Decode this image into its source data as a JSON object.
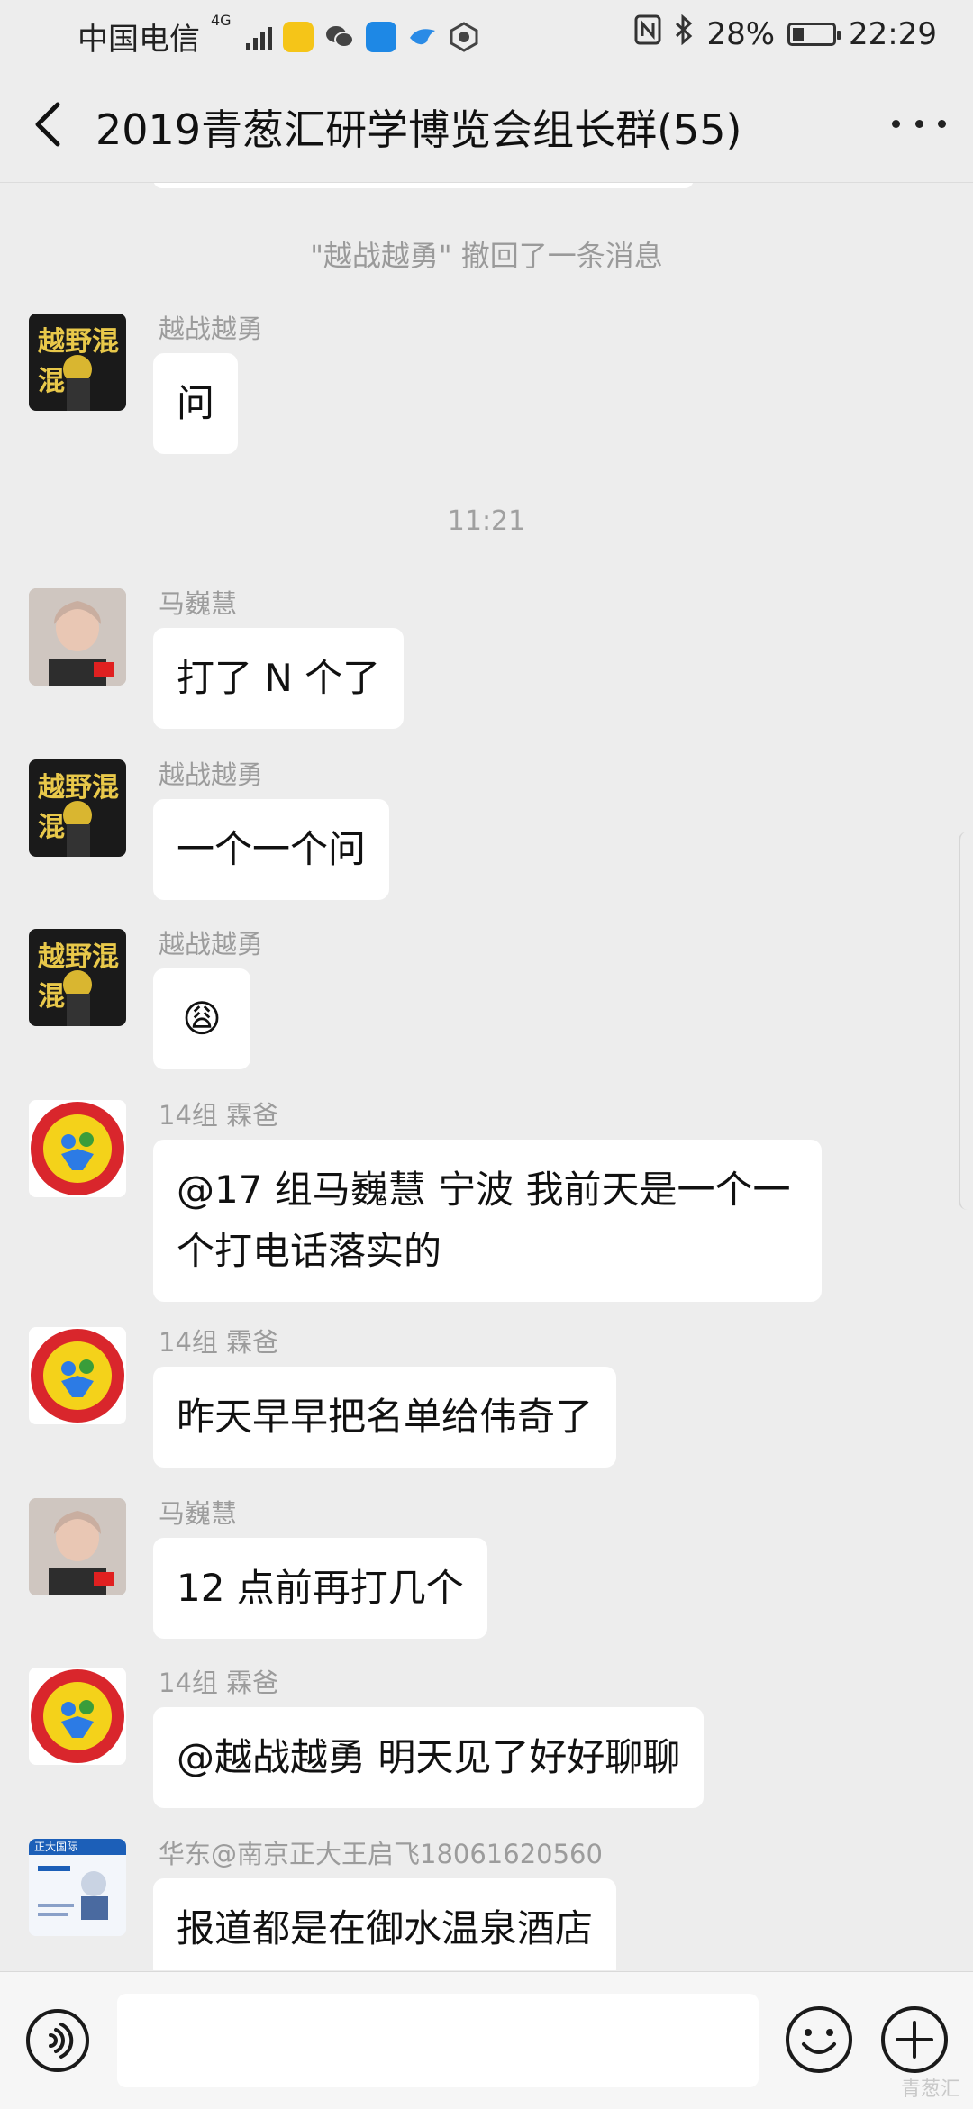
{
  "status_bar": {
    "carrier": "中国电信",
    "network": "4G",
    "battery": "28%",
    "time": "22:29"
  },
  "nav": {
    "title": "2019青葱汇研学博览会组长群(55)"
  },
  "system_notice": "\"越战越勇\" 撤回了一条消息",
  "timestamp": "11:21",
  "messages": [
    {
      "sender": "越战越勇",
      "text": "问",
      "avatar": "yuezhan-avatar"
    },
    {
      "sender": "马巍慧",
      "text": "打了 N 个了",
      "avatar": "maweihui-avatar"
    },
    {
      "sender": "越战越勇",
      "text": "一个一个问",
      "avatar": "yuezhan-avatar"
    },
    {
      "sender": "越战越勇",
      "text": "😩",
      "avatar": "yuezhan-avatar"
    },
    {
      "sender": "14组  霖爸",
      "text": "@17 组马巍慧  宁波  我前天是一个一个打电话落实的",
      "avatar": "linba-avatar"
    },
    {
      "sender": "14组  霖爸",
      "text": "昨天早早把名单给伟奇了",
      "avatar": "linba-avatar"
    },
    {
      "sender": "马巍慧",
      "text": "12 点前再打几个",
      "avatar": "maweihui-avatar"
    },
    {
      "sender": "14组  霖爸",
      "text": "@越战越勇  明天见了好好聊聊",
      "avatar": "linba-avatar"
    },
    {
      "sender": "华东@南京正大王启飞18061620560",
      "text": "报道都是在御水温泉酒店",
      "avatar": "wangqifei-avatar"
    }
  ],
  "avatar_text": {
    "yuezhan": "越野混混",
    "card_brand": "正大国际"
  },
  "watermark": "青葱汇",
  "colors": {
    "background": "#ededed",
    "bubble": "#ffffff",
    "sender_name": "#9c9c9c"
  }
}
